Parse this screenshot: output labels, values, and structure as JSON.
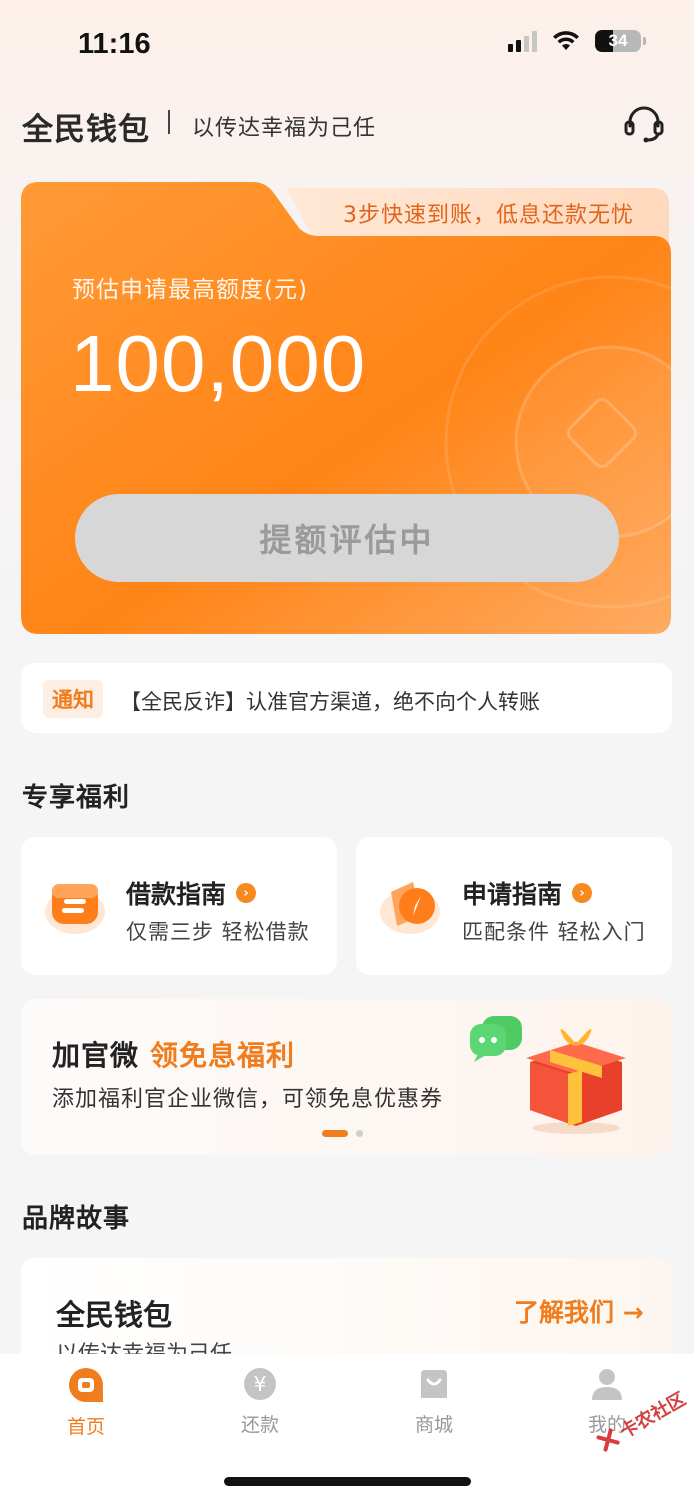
{
  "status_bar": {
    "time": "11:16",
    "battery": "34"
  },
  "header": {
    "brand": "全民钱包",
    "slogan": "以传达幸福为己任"
  },
  "quota_card": {
    "tab_text": "3步快速到账，低息还款无忧",
    "label": "预估申请最高额度(元)",
    "amount": "100,000",
    "button_label": "提额评估中"
  },
  "notice": {
    "badge": "通知",
    "text": "【全民反诈】认准官方渠道，绝不向个人转账"
  },
  "benefits": {
    "title": "专享福利",
    "cards": [
      {
        "title": "借款指南",
        "subtitle": "仅需三步 轻松借款",
        "icon": "loan-guide-icon"
      },
      {
        "title": "申请指南",
        "subtitle": "匹配条件 轻松入门",
        "icon": "apply-guide-icon"
      }
    ]
  },
  "banner": {
    "title": "加官微",
    "title_accent": "领免息福利",
    "subtitle": "添加福利官企业微信，可领免息优惠券"
  },
  "brand_story": {
    "title": "品牌故事",
    "card_title": "全民钱包",
    "link": "了解我们 →",
    "card_subtitle": "以传达幸福为己任"
  },
  "tabbar": {
    "items": [
      {
        "label": "首页",
        "icon": "home-icon",
        "active": true
      },
      {
        "label": "还款",
        "icon": "yuan-icon",
        "active": false
      },
      {
        "label": "商城",
        "icon": "shopping-bag-icon",
        "active": false
      },
      {
        "label": "我的",
        "icon": "person-icon",
        "active": false
      }
    ]
  },
  "watermark": "卡农社区",
  "colors": {
    "accent": "#f07d1d",
    "card": "#ff8a1f"
  }
}
